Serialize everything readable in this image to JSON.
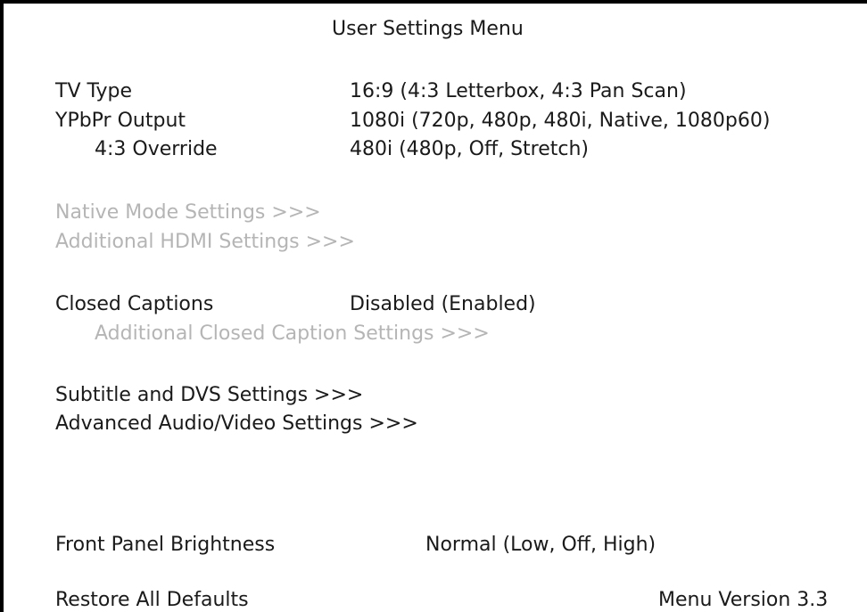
{
  "menu": {
    "title": "User Settings Menu",
    "tv_type": {
      "label": "TV Type",
      "value": "16:9 (4:3 Letterbox, 4:3 Pan Scan)"
    },
    "ypbpr_output": {
      "label": "YPbPr Output",
      "value": "1080i (720p, 480p, 480i, Native, 1080p60)"
    },
    "override_43": {
      "label": "4:3 Override",
      "value": "480i (480p, Off, Stretch)"
    },
    "native_mode": {
      "label": "Native Mode Settings >>>"
    },
    "additional_hdmi": {
      "label": "Additional HDMI Settings >>>"
    },
    "closed_captions": {
      "label": "Closed Captions",
      "value": "Disabled (Enabled)"
    },
    "additional_cc": {
      "label": "Additional Closed Caption Settings >>>"
    },
    "subtitle_dvs": {
      "label": "Subtitle and DVS Settings >>>"
    },
    "advanced_av": {
      "label": "Advanced Audio/Video Settings >>>"
    },
    "front_panel": {
      "label": "Front Panel Brightness",
      "value": "Normal (Low, Off, High)"
    },
    "restore_defaults": {
      "label": "Restore All Defaults"
    },
    "version": "Menu Version 3.3"
  },
  "colors": {
    "text": "#1a1a1a",
    "disabled_text": "#b5b5b5",
    "background": "#ffffff",
    "border": "#000000"
  }
}
